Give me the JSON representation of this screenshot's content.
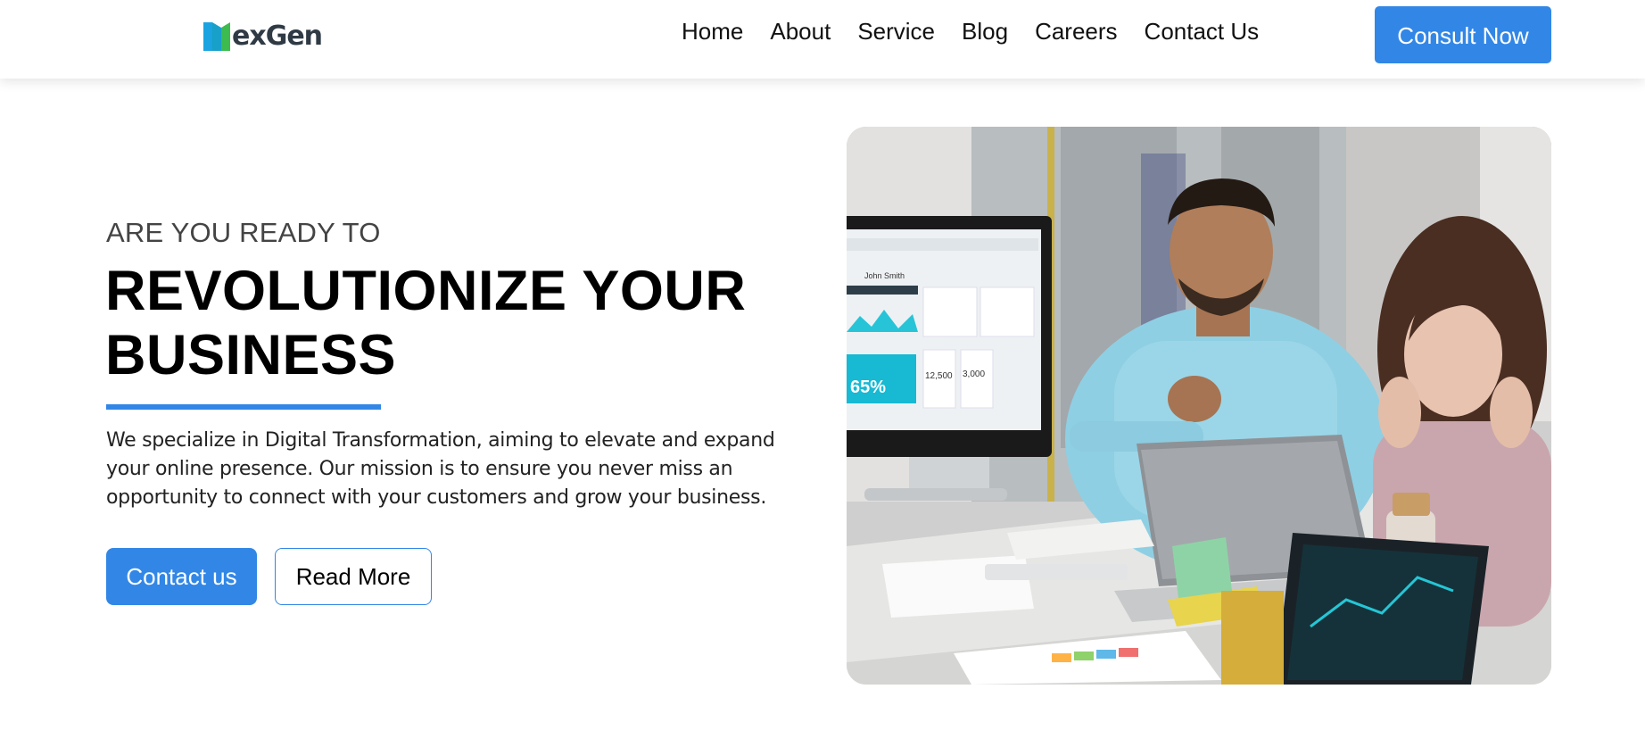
{
  "header": {
    "logo_text": "exGen",
    "nav": [
      "Home",
      "About",
      "Service",
      "Blog",
      "Careers",
      "Contact Us"
    ],
    "cta_label": "Consult Now"
  },
  "hero": {
    "eyebrow": "ARE YOU READY TO",
    "headline_line1": "REVOLUTIONIZE YOUR",
    "headline_line2": "BUSINESS",
    "description": "We specialize in Digital Transformation, aiming to elevate and expand your online presence. Our mission is to ensure you never miss an opportunity to connect with your customers and grow your business.",
    "primary_button": "Contact us",
    "secondary_button": "Read More",
    "monitor_name": "John Smith",
    "monitor_percent": "65%",
    "monitor_stat_1": "12,500",
    "monitor_stat_2": "3,000"
  },
  "colors": {
    "accent": "#3287e6",
    "logo_blue": "#1aa3e0",
    "logo_green": "#3dbb4e"
  }
}
